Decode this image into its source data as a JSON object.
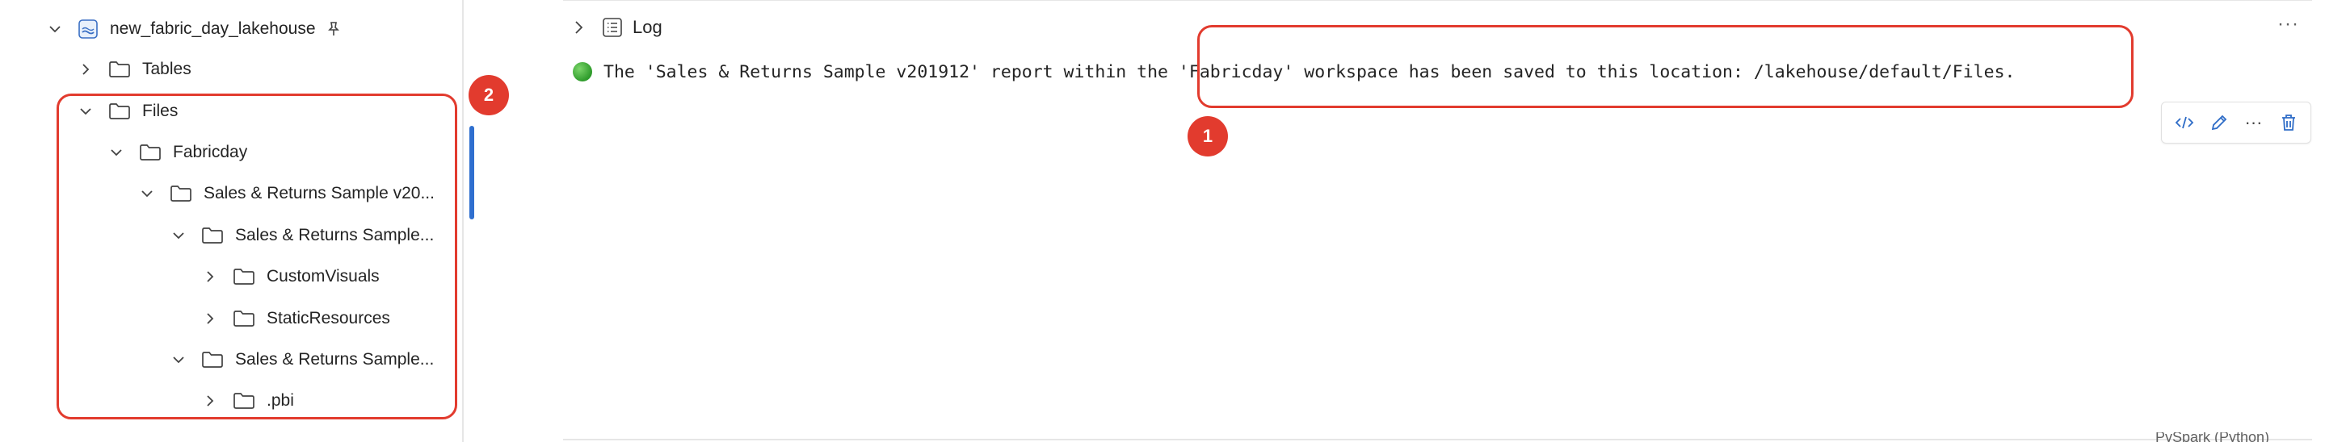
{
  "explorer": {
    "lakehouse_name": "new_fabric_day_lakehouse",
    "items": [
      {
        "label": "Tables",
        "expanded": false
      },
      {
        "label": "Files",
        "expanded": true
      },
      {
        "label": "Fabricday",
        "expanded": true
      },
      {
        "label": "Sales & Returns Sample v20...",
        "expanded": true
      },
      {
        "label": "Sales & Returns Sample...",
        "expanded": true
      },
      {
        "label": "CustomVisuals",
        "expanded": false
      },
      {
        "label": "StaticResources",
        "expanded": false
      },
      {
        "label": "Sales & Returns Sample...",
        "expanded": true
      },
      {
        "label": ".pbi",
        "expanded": false
      }
    ]
  },
  "annotations": {
    "badge_1": "1",
    "badge_2": "2",
    "accent_color": "#e23b2e"
  },
  "cell": {
    "log_label": "Log",
    "more_label": "···",
    "output_message": "The 'Sales & Returns Sample v201912' report within the 'Fabricday' workspace has been saved to this location: /lakehouse/default/Files.",
    "toolbar": {
      "code_icon": "code-icon",
      "edit_icon": "pencil-icon",
      "more_label": "···",
      "delete_icon": "trash-icon"
    },
    "bottom_text": "PySpark (Python)"
  }
}
